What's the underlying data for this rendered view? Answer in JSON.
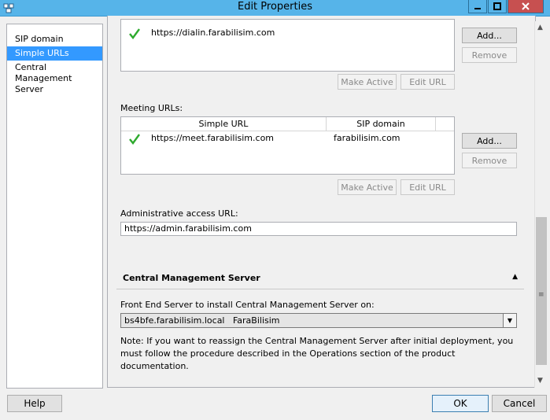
{
  "window": {
    "title": "Edit Properties"
  },
  "nav": {
    "items": [
      {
        "label": "SIP domain",
        "selected": false
      },
      {
        "label": "Simple URLs",
        "selected": true
      },
      {
        "label": "Central Management Server",
        "selected": false
      }
    ]
  },
  "dialin": {
    "url": "https://dialin.farabilisim.com",
    "add_label": "Add...",
    "remove_label": "Remove",
    "make_active_label": "Make Active",
    "edit_url_label": "Edit URL"
  },
  "meeting": {
    "section_label": "Meeting URLs:",
    "col_simple_url": "Simple URL",
    "col_sip_domain": "SIP domain",
    "rows": [
      {
        "url": "https://meet.farabilisim.com",
        "domain": "farabilisim.com"
      }
    ],
    "add_label": "Add...",
    "remove_label": "Remove",
    "make_active_label": "Make Active",
    "edit_url_label": "Edit URL"
  },
  "admin": {
    "label": "Administrative access URL:",
    "value": "https://admin.farabilisim.com"
  },
  "cms": {
    "title": "Central Management Server",
    "front_end_label": "Front End Server to install Central Management Server on:",
    "selected_server": "bs4bfe.farabilisim.local   FaraBilisim",
    "note": "Note: If you want to reassign the Central Management Server after initial deployment, you must follow the procedure described in the Operations section of the product documentation."
  },
  "footer": {
    "help_label": "Help",
    "ok_label": "OK",
    "cancel_label": "Cancel"
  },
  "colors": {
    "titlebar": "#56b4e9",
    "selection": "#3399ff",
    "check": "#2eaa2e"
  },
  "icons": [
    "app-icon",
    "minimize-icon",
    "maximize-icon",
    "close-icon",
    "checkmark-icon",
    "collapse-icon",
    "dropdown-icon",
    "scroll-up-icon",
    "scroll-down-icon"
  ]
}
